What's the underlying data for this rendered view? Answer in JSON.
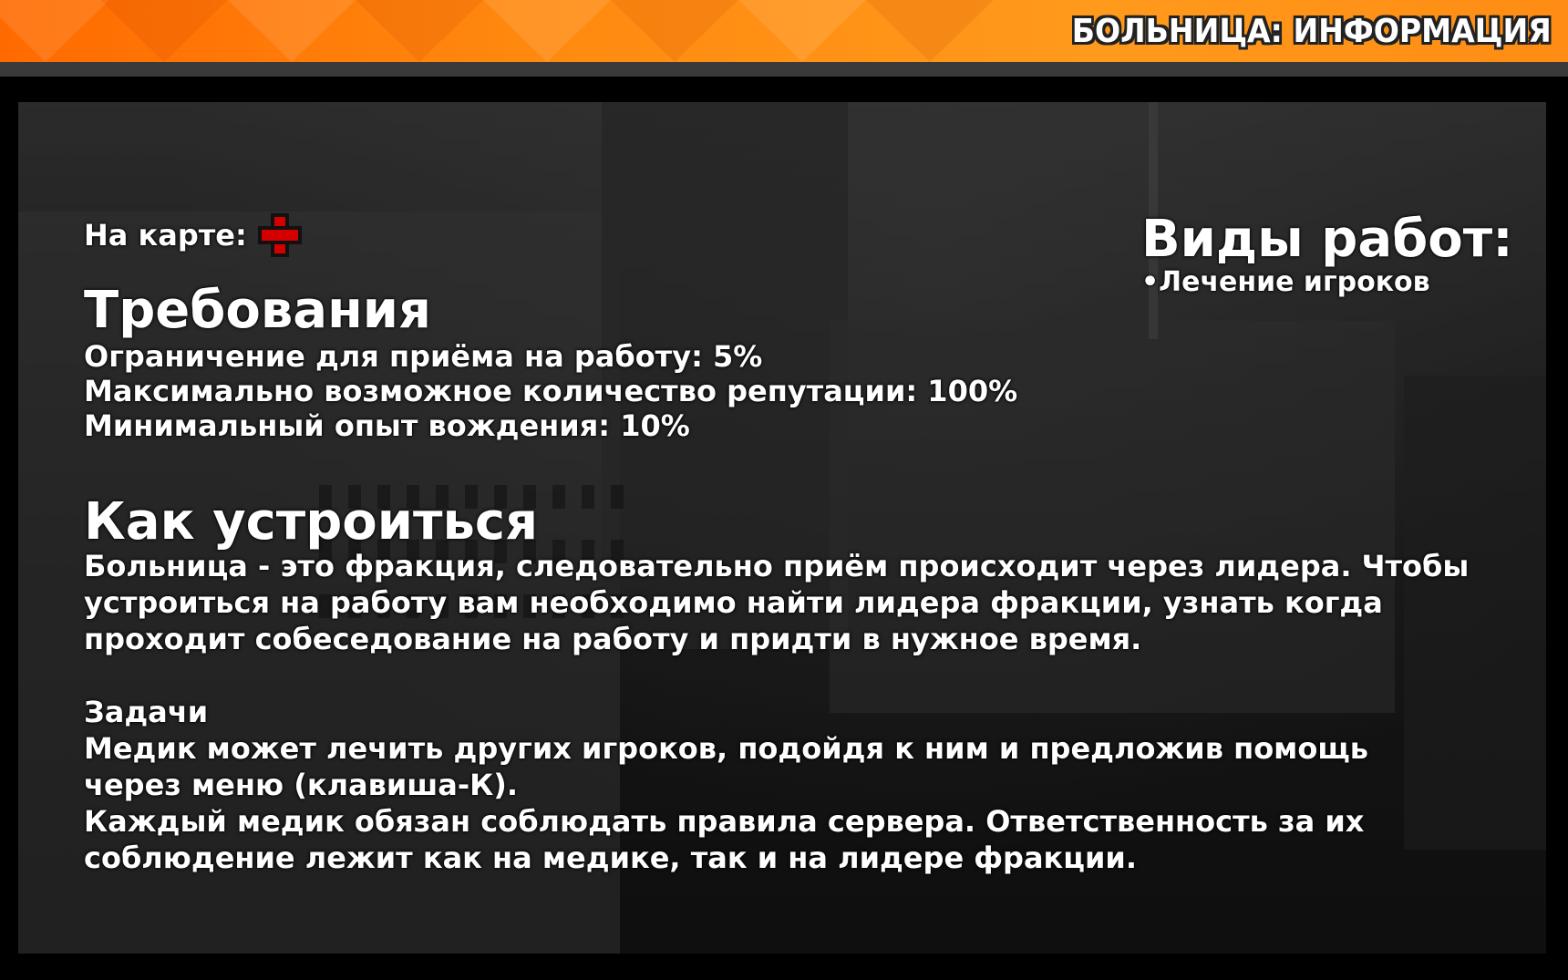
{
  "header": {
    "title": "БОЛЬНИЦА: ИНФОРМАЦИЯ",
    "accent_color": "#ff8a10"
  },
  "map": {
    "label": "На карте:",
    "icon": "red-cross-icon"
  },
  "requirements": {
    "title": "Требования",
    "lines": [
      "Ограничение для приёма на работу: 5%",
      "Максимально возможное количество репутации: 100%",
      "Минимальный опыт вождения: 10%"
    ]
  },
  "how_to_join": {
    "title": "Как устроиться",
    "lines": [
      "Больница - это фракция, следовательно приём происходит через лидера. Чтобы",
      "устроиться на работу вам необходимо найти лидера фракции, узнать когда",
      "проходит собеседование на работу и придти в нужное время."
    ]
  },
  "tasks": {
    "title": "Задачи",
    "lines": [
      "Медик может лечить других игроков, подойдя к ним и предложив помощь",
      "через меню (клавиша-К).",
      "Каждый медик обязан соблюдать правила сервера. Ответственность за их",
      "соблюдение лежит как на медике, так и на лидере фракции."
    ]
  },
  "job_types": {
    "title": "Виды работ:",
    "items": [
      "•Лечение игроков"
    ]
  }
}
